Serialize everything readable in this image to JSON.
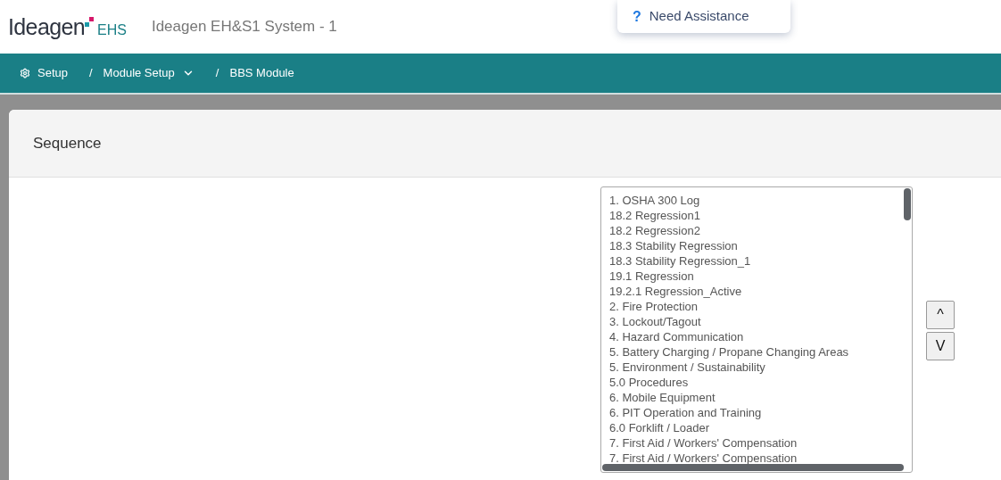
{
  "header": {
    "logo_text": "Ideagen",
    "logo_suffix": "EHS",
    "system_name": "Ideagen EH&S1 System - 1",
    "help_button": {
      "icon": "?",
      "label": "Need Assistance"
    }
  },
  "breadcrumb": [
    {
      "label": "Setup",
      "kind": "settings"
    },
    {
      "label": "Module Setup",
      "kind": "dropdown"
    },
    {
      "label": "BBS Module",
      "kind": "plain"
    }
  ],
  "breadcrumb_separator": "/",
  "panel": {
    "title": "Sequence"
  },
  "sequence_list": [
    "1. OSHA 300 Log",
    "18.2 Regression1",
    "18.2 Regression2",
    "18.3 Stability Regression",
    "18.3 Stability Regression_1",
    "19.1 Regression",
    "19.2.1 Regression_Active",
    "2. Fire Protection",
    "3. Lockout/Tagout",
    "4. Hazard Communication",
    "5. Battery Charging / Propane Changing Areas",
    "5. Environment / Sustainability",
    "5.0 Procedures",
    "6. Mobile Equipment",
    "6. PIT Operation and Training",
    "6.0 Forklift / Loader",
    "7. First Aid / Workers' Compensation",
    "7. First Aid / Workers' Compensation"
  ],
  "move_buttons": [
    "^",
    "V"
  ]
}
